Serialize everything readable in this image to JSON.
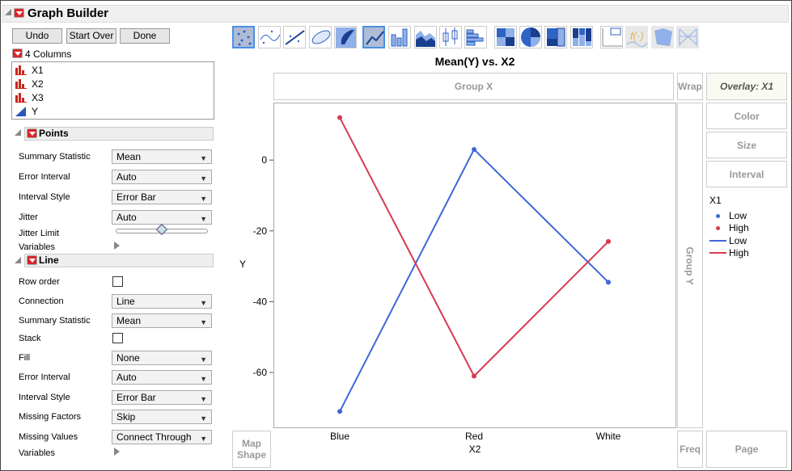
{
  "window": {
    "title": "Graph Builder"
  },
  "buttons": {
    "undo": "Undo",
    "start_over": "Start Over",
    "done": "Done"
  },
  "columns": {
    "header": "4 Columns",
    "items": [
      {
        "name": "X1",
        "type": "nominal"
      },
      {
        "name": "X2",
        "type": "nominal"
      },
      {
        "name": "X3",
        "type": "nominal"
      },
      {
        "name": "Y",
        "type": "continuous"
      }
    ]
  },
  "points": {
    "title": "Points",
    "rows": [
      {
        "label": "Summary Statistic",
        "control": "select",
        "value": "Mean"
      },
      {
        "label": "Error Interval",
        "control": "select",
        "value": "Auto"
      },
      {
        "label": "Interval Style",
        "control": "select",
        "value": "Error Bar"
      },
      {
        "label": "Jitter",
        "control": "select",
        "value": "Auto"
      },
      {
        "label": "Jitter Limit",
        "control": "slider",
        "value": 0.5
      },
      {
        "label": "Variables",
        "control": "disclosure"
      }
    ]
  },
  "line": {
    "title": "Line",
    "rows": [
      {
        "label": "Row order",
        "control": "checkbox",
        "value": false
      },
      {
        "label": "Connection",
        "control": "select",
        "value": "Line"
      },
      {
        "label": "Summary Statistic",
        "control": "select",
        "value": "Mean"
      },
      {
        "label": "Stack",
        "control": "checkbox",
        "value": false
      },
      {
        "label": "Fill",
        "control": "select",
        "value": "None"
      },
      {
        "label": "Error Interval",
        "control": "select",
        "value": "Auto"
      },
      {
        "label": "Interval Style",
        "control": "select",
        "value": "Error Bar"
      },
      {
        "label": "Missing Factors",
        "control": "select",
        "value": "Skip"
      },
      {
        "label": "Missing Values",
        "control": "select",
        "value": "Connect Through"
      },
      {
        "label": "Variables",
        "control": "disclosure"
      }
    ]
  },
  "toolbar": [
    "points",
    "smoother",
    "line-of-fit",
    "ellipse",
    "contour",
    "line",
    "bar",
    "area",
    "box-plot",
    "histogram",
    "heatmap",
    "pie",
    "treemap",
    "mosaic",
    "caption-box",
    "formula",
    "map-shapes",
    "parallel"
  ],
  "zones": {
    "group_x": "Group X",
    "group_y": "Group Y",
    "wrap": "Wrap",
    "overlay": "Overlay: X1",
    "color": "Color",
    "size": "Size",
    "interval": "Interval",
    "freq": "Freq",
    "page": "Page",
    "map_shape": "Map Shape"
  },
  "legend": {
    "title": "X1",
    "items": [
      {
        "kind": "point",
        "label": "Low",
        "color": "#3f66d8"
      },
      {
        "kind": "point",
        "label": "High",
        "color": "#d63a4f"
      },
      {
        "kind": "line",
        "label": "Low",
        "color": "#3f66d8"
      },
      {
        "kind": "line",
        "label": "High",
        "color": "#d63a4f"
      }
    ]
  },
  "chart_data": {
    "type": "line",
    "title": "Mean(Y) vs. X2",
    "xlabel": "X2",
    "ylabel": "Y",
    "categories": [
      "Blue",
      "Red",
      "White"
    ],
    "series": [
      {
        "name": "Low",
        "color": "#3f66d8",
        "values": [
          -71,
          3,
          -34.5
        ]
      },
      {
        "name": "High",
        "color": "#d63a4f",
        "values": [
          12,
          -61,
          -23
        ]
      }
    ],
    "yticks": [
      0,
      -20,
      -40,
      -60
    ],
    "ylim": [
      -75.5,
      16
    ]
  }
}
